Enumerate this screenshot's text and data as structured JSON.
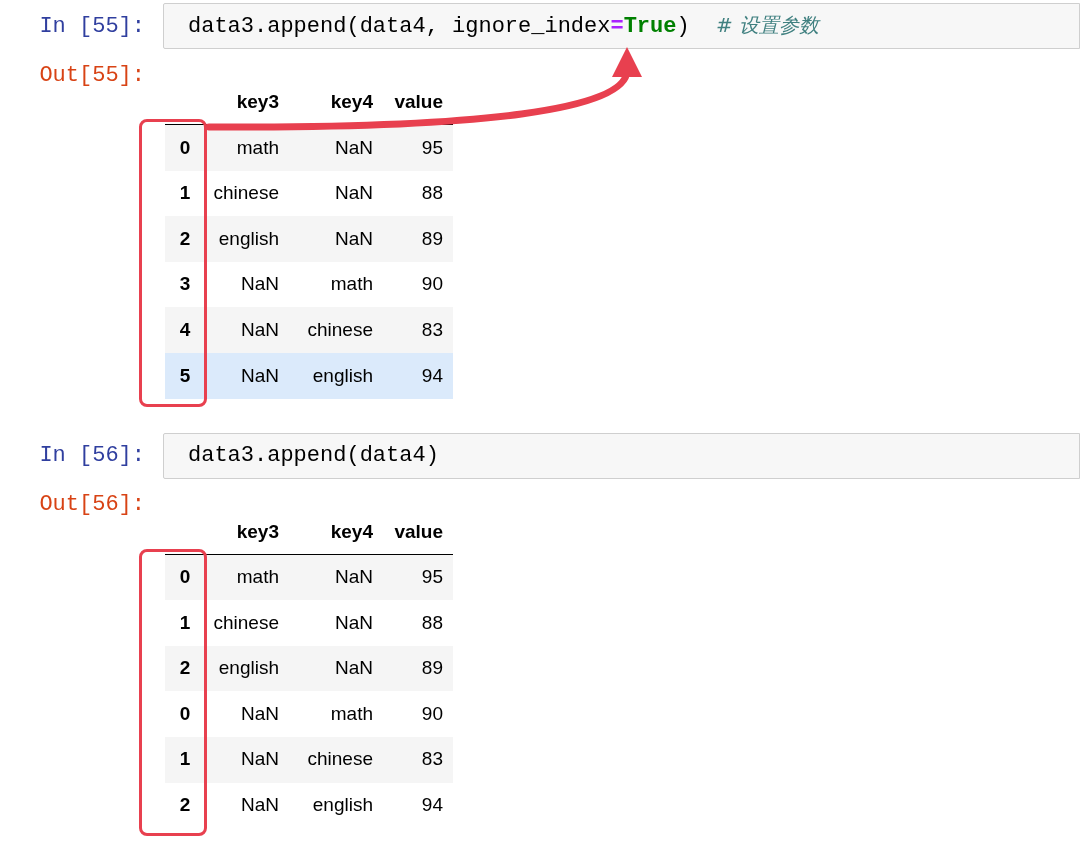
{
  "arrow": true,
  "cells": [
    {
      "in_prompt": "In [55]:",
      "code": [
        {
          "kind": "plain",
          "text": "data3.append(data4, ignore_index"
        },
        {
          "kind": "operator",
          "text": "="
        },
        {
          "kind": "keyword",
          "text": "True"
        },
        {
          "kind": "plain",
          "text": ")  "
        },
        {
          "kind": "comment",
          "text": "# 设置参数"
        }
      ],
      "out_prompt": "Out[55]:",
      "table": {
        "columns": [
          "key3",
          "key4",
          "value"
        ],
        "rows": [
          {
            "index": "0",
            "cells": [
              "math",
              "NaN",
              "95"
            ],
            "highlighted": false
          },
          {
            "index": "1",
            "cells": [
              "chinese",
              "NaN",
              "88"
            ],
            "highlighted": false
          },
          {
            "index": "2",
            "cells": [
              "english",
              "NaN",
              "89"
            ],
            "highlighted": false
          },
          {
            "index": "3",
            "cells": [
              "NaN",
              "math",
              "90"
            ],
            "highlighted": false
          },
          {
            "index": "4",
            "cells": [
              "NaN",
              "chinese",
              "83"
            ],
            "highlighted": false
          },
          {
            "index": "5",
            "cells": [
              "NaN",
              "english",
              "94"
            ],
            "highlighted": true
          }
        ]
      }
    },
    {
      "in_prompt": "In [56]:",
      "code": [
        {
          "kind": "plain",
          "text": "data3.append(data4)"
        }
      ],
      "out_prompt": "Out[56]:",
      "table": {
        "columns": [
          "key3",
          "key4",
          "value"
        ],
        "rows": [
          {
            "index": "0",
            "cells": [
              "math",
              "NaN",
              "95"
            ],
            "highlighted": false
          },
          {
            "index": "1",
            "cells": [
              "chinese",
              "NaN",
              "88"
            ],
            "highlighted": false
          },
          {
            "index": "2",
            "cells": [
              "english",
              "NaN",
              "89"
            ],
            "highlighted": false
          },
          {
            "index": "0",
            "cells": [
              "NaN",
              "math",
              "90"
            ],
            "highlighted": false
          },
          {
            "index": "1",
            "cells": [
              "NaN",
              "chinese",
              "83"
            ],
            "highlighted": false
          },
          {
            "index": "2",
            "cells": [
              "NaN",
              "english",
              "94"
            ],
            "highlighted": false
          }
        ]
      }
    }
  ]
}
